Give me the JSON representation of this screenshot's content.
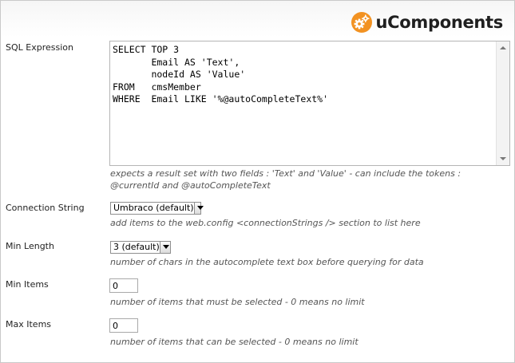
{
  "logo": {
    "text": "uComponents",
    "icon": "gears-icon",
    "accent_color": "#f29222"
  },
  "sql_expression": {
    "label": "SQL Expression",
    "value": "SELECT TOP 3\n       Email AS 'Text',\n       nodeId AS 'Value'\nFROM   cmsMember\nWHERE  Email LIKE '%@autoCompleteText%'",
    "hint": "expects a result set with two fields : 'Text' and 'Value' - can include the tokens : @currentId and @autoCompleteText"
  },
  "connection_string": {
    "label": "Connection String",
    "selected": "Umbraco (default)",
    "hint": "add items to the web.config <connectionStrings /> section to list here"
  },
  "min_length": {
    "label": "Min Length",
    "selected": "3 (default)",
    "hint": "number of chars in the autocomplete text box before querying for data"
  },
  "min_items": {
    "label": "Min Items",
    "value": "0",
    "hint": "number of items that must be selected - 0 means no limit"
  },
  "max_items": {
    "label": "Max Items",
    "value": "0",
    "hint": "number of items that can be selected - 0 means no limit"
  }
}
